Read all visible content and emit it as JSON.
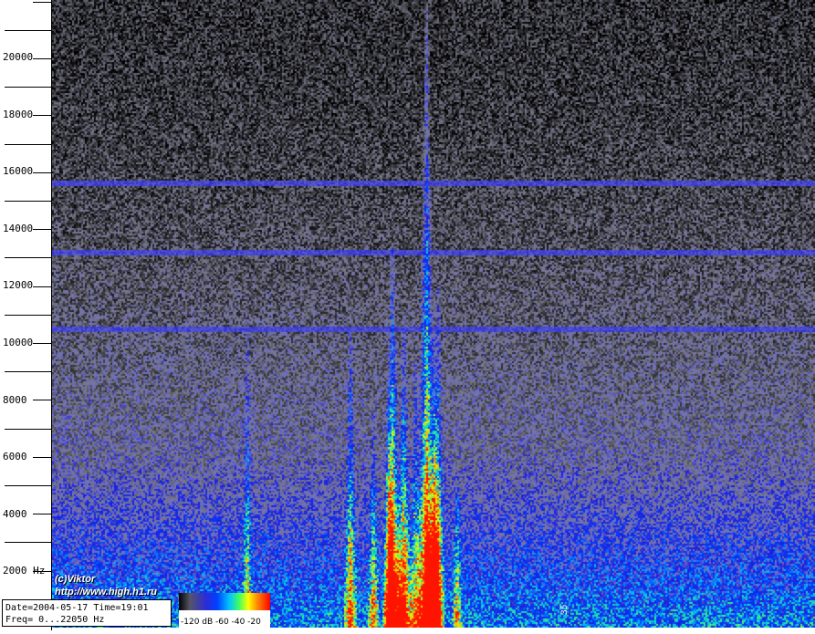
{
  "chart_data": {
    "type": "heatmap",
    "title": "",
    "xlabel": "",
    "ylabel": "",
    "y_unit": "Hz",
    "ylim": [
      0,
      22050
    ],
    "y_ticks": [
      2000,
      4000,
      6000,
      8000,
      10000,
      12000,
      14000,
      16000,
      18000,
      20000
    ],
    "y_tick_labels": [
      "2000 Hz",
      "4000",
      "6000",
      "8000",
      "10000",
      "12000",
      "14000",
      "16000",
      "18000",
      "20000"
    ],
    "x_ticks": [
      {
        "label": "35",
        "pos": 0.67
      }
    ],
    "colorbar": {
      "label": "-120 dB   -60 -40 -20",
      "range_db": [
        -120,
        -20
      ],
      "ticks_db": [
        -120,
        -60,
        -40,
        -20
      ],
      "colors": [
        "#000000",
        "#555566",
        "#2b2bd8",
        "#00c0ff",
        "#40ff60",
        "#ffff00",
        "#ff0000"
      ]
    },
    "features": {
      "horizontal_lines_hz": [
        15650,
        13200,
        10500
      ],
      "vertical_events": [
        {
          "t": 0.255,
          "max_hz": 10500,
          "strength": 0.45
        },
        {
          "t": 0.39,
          "max_hz": 10500,
          "strength": 0.6
        },
        {
          "t": 0.42,
          "max_hz": 7500,
          "strength": 0.5
        },
        {
          "t": 0.44,
          "max_hz": 9000,
          "strength": 0.4
        },
        {
          "t": 0.445,
          "max_hz": 13500,
          "strength": 0.95
        },
        {
          "t": 0.46,
          "max_hz": 11000,
          "strength": 0.8
        },
        {
          "t": 0.475,
          "max_hz": 9500,
          "strength": 0.55
        },
        {
          "t": 0.5,
          "max_hz": 10500,
          "strength": 0.6
        },
        {
          "t": 0.505,
          "max_hz": 12000,
          "strength": 0.7
        },
        {
          "t": 0.49,
          "max_hz": 22050,
          "strength": 1.0
        },
        {
          "t": 0.53,
          "max_hz": 5000,
          "strength": 0.45
        }
      ]
    },
    "credit": [
      "(c)Viktor",
      "http://www.high.h1.ru"
    ],
    "info": [
      "Date=2004-05-17 Time=19:01",
      "Freq= 0...22050 Hz"
    ]
  }
}
